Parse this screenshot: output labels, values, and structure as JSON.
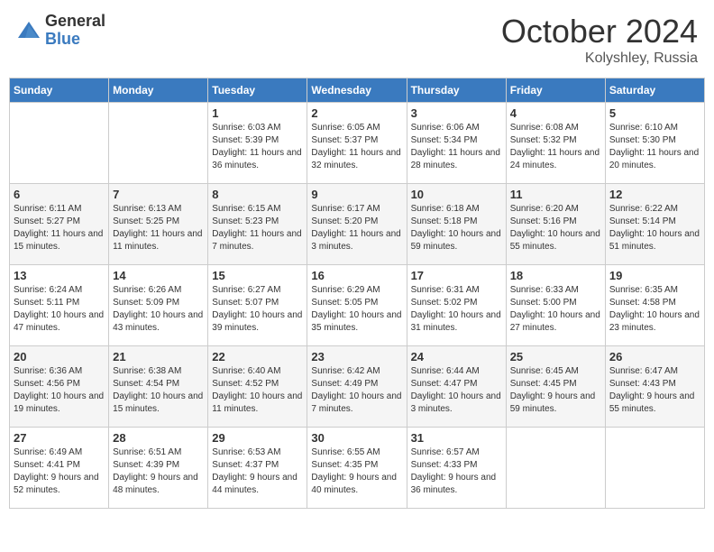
{
  "header": {
    "logo_general": "General",
    "logo_blue": "Blue",
    "month_title": "October 2024",
    "location": "Kolyshley, Russia"
  },
  "weekdays": [
    "Sunday",
    "Monday",
    "Tuesday",
    "Wednesday",
    "Thursday",
    "Friday",
    "Saturday"
  ],
  "weeks": [
    [
      {
        "day": "",
        "sunrise": "",
        "sunset": "",
        "daylight": ""
      },
      {
        "day": "",
        "sunrise": "",
        "sunset": "",
        "daylight": ""
      },
      {
        "day": "1",
        "sunrise": "Sunrise: 6:03 AM",
        "sunset": "Sunset: 5:39 PM",
        "daylight": "Daylight: 11 hours and 36 minutes."
      },
      {
        "day": "2",
        "sunrise": "Sunrise: 6:05 AM",
        "sunset": "Sunset: 5:37 PM",
        "daylight": "Daylight: 11 hours and 32 minutes."
      },
      {
        "day": "3",
        "sunrise": "Sunrise: 6:06 AM",
        "sunset": "Sunset: 5:34 PM",
        "daylight": "Daylight: 11 hours and 28 minutes."
      },
      {
        "day": "4",
        "sunrise": "Sunrise: 6:08 AM",
        "sunset": "Sunset: 5:32 PM",
        "daylight": "Daylight: 11 hours and 24 minutes."
      },
      {
        "day": "5",
        "sunrise": "Sunrise: 6:10 AM",
        "sunset": "Sunset: 5:30 PM",
        "daylight": "Daylight: 11 hours and 20 minutes."
      }
    ],
    [
      {
        "day": "6",
        "sunrise": "Sunrise: 6:11 AM",
        "sunset": "Sunset: 5:27 PM",
        "daylight": "Daylight: 11 hours and 15 minutes."
      },
      {
        "day": "7",
        "sunrise": "Sunrise: 6:13 AM",
        "sunset": "Sunset: 5:25 PM",
        "daylight": "Daylight: 11 hours and 11 minutes."
      },
      {
        "day": "8",
        "sunrise": "Sunrise: 6:15 AM",
        "sunset": "Sunset: 5:23 PM",
        "daylight": "Daylight: 11 hours and 7 minutes."
      },
      {
        "day": "9",
        "sunrise": "Sunrise: 6:17 AM",
        "sunset": "Sunset: 5:20 PM",
        "daylight": "Daylight: 11 hours and 3 minutes."
      },
      {
        "day": "10",
        "sunrise": "Sunrise: 6:18 AM",
        "sunset": "Sunset: 5:18 PM",
        "daylight": "Daylight: 10 hours and 59 minutes."
      },
      {
        "day": "11",
        "sunrise": "Sunrise: 6:20 AM",
        "sunset": "Sunset: 5:16 PM",
        "daylight": "Daylight: 10 hours and 55 minutes."
      },
      {
        "day": "12",
        "sunrise": "Sunrise: 6:22 AM",
        "sunset": "Sunset: 5:14 PM",
        "daylight": "Daylight: 10 hours and 51 minutes."
      }
    ],
    [
      {
        "day": "13",
        "sunrise": "Sunrise: 6:24 AM",
        "sunset": "Sunset: 5:11 PM",
        "daylight": "Daylight: 10 hours and 47 minutes."
      },
      {
        "day": "14",
        "sunrise": "Sunrise: 6:26 AM",
        "sunset": "Sunset: 5:09 PM",
        "daylight": "Daylight: 10 hours and 43 minutes."
      },
      {
        "day": "15",
        "sunrise": "Sunrise: 6:27 AM",
        "sunset": "Sunset: 5:07 PM",
        "daylight": "Daylight: 10 hours and 39 minutes."
      },
      {
        "day": "16",
        "sunrise": "Sunrise: 6:29 AM",
        "sunset": "Sunset: 5:05 PM",
        "daylight": "Daylight: 10 hours and 35 minutes."
      },
      {
        "day": "17",
        "sunrise": "Sunrise: 6:31 AM",
        "sunset": "Sunset: 5:02 PM",
        "daylight": "Daylight: 10 hours and 31 minutes."
      },
      {
        "day": "18",
        "sunrise": "Sunrise: 6:33 AM",
        "sunset": "Sunset: 5:00 PM",
        "daylight": "Daylight: 10 hours and 27 minutes."
      },
      {
        "day": "19",
        "sunrise": "Sunrise: 6:35 AM",
        "sunset": "Sunset: 4:58 PM",
        "daylight": "Daylight: 10 hours and 23 minutes."
      }
    ],
    [
      {
        "day": "20",
        "sunrise": "Sunrise: 6:36 AM",
        "sunset": "Sunset: 4:56 PM",
        "daylight": "Daylight: 10 hours and 19 minutes."
      },
      {
        "day": "21",
        "sunrise": "Sunrise: 6:38 AM",
        "sunset": "Sunset: 4:54 PM",
        "daylight": "Daylight: 10 hours and 15 minutes."
      },
      {
        "day": "22",
        "sunrise": "Sunrise: 6:40 AM",
        "sunset": "Sunset: 4:52 PM",
        "daylight": "Daylight: 10 hours and 11 minutes."
      },
      {
        "day": "23",
        "sunrise": "Sunrise: 6:42 AM",
        "sunset": "Sunset: 4:49 PM",
        "daylight": "Daylight: 10 hours and 7 minutes."
      },
      {
        "day": "24",
        "sunrise": "Sunrise: 6:44 AM",
        "sunset": "Sunset: 4:47 PM",
        "daylight": "Daylight: 10 hours and 3 minutes."
      },
      {
        "day": "25",
        "sunrise": "Sunrise: 6:45 AM",
        "sunset": "Sunset: 4:45 PM",
        "daylight": "Daylight: 9 hours and 59 minutes."
      },
      {
        "day": "26",
        "sunrise": "Sunrise: 6:47 AM",
        "sunset": "Sunset: 4:43 PM",
        "daylight": "Daylight: 9 hours and 55 minutes."
      }
    ],
    [
      {
        "day": "27",
        "sunrise": "Sunrise: 6:49 AM",
        "sunset": "Sunset: 4:41 PM",
        "daylight": "Daylight: 9 hours and 52 minutes."
      },
      {
        "day": "28",
        "sunrise": "Sunrise: 6:51 AM",
        "sunset": "Sunset: 4:39 PM",
        "daylight": "Daylight: 9 hours and 48 minutes."
      },
      {
        "day": "29",
        "sunrise": "Sunrise: 6:53 AM",
        "sunset": "Sunset: 4:37 PM",
        "daylight": "Daylight: 9 hours and 44 minutes."
      },
      {
        "day": "30",
        "sunrise": "Sunrise: 6:55 AM",
        "sunset": "Sunset: 4:35 PM",
        "daylight": "Daylight: 9 hours and 40 minutes."
      },
      {
        "day": "31",
        "sunrise": "Sunrise: 6:57 AM",
        "sunset": "Sunset: 4:33 PM",
        "daylight": "Daylight: 9 hours and 36 minutes."
      },
      {
        "day": "",
        "sunrise": "",
        "sunset": "",
        "daylight": ""
      },
      {
        "day": "",
        "sunrise": "",
        "sunset": "",
        "daylight": ""
      }
    ]
  ]
}
